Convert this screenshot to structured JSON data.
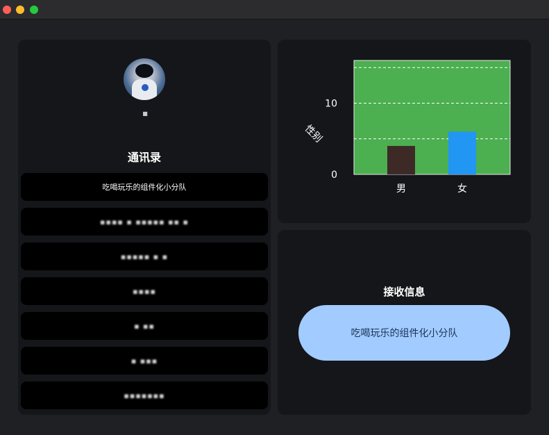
{
  "window": {
    "controls": [
      "close",
      "minimize",
      "zoom"
    ]
  },
  "profile": {
    "avatar": "astronaut-avatar",
    "username": "■"
  },
  "contacts": {
    "title": "通讯录",
    "items": [
      {
        "label": "吃喝玩乐的组件化小分队",
        "blurred": false
      },
      {
        "label": "▪▪▪▪ ▪ ▪▪▪▪▪ ▪▪ ▪",
        "blurred": true
      },
      {
        "label": "▪▪▪▪▪ ▪ ▪",
        "blurred": true
      },
      {
        "label": "▪▪▪▪",
        "blurred": true
      },
      {
        "label": "▪ ▪▪",
        "blurred": true
      },
      {
        "label": "▪ ▪▪▪",
        "blurred": true
      },
      {
        "label": "▪▪▪▪▪▪▪",
        "blurred": true
      }
    ]
  },
  "chart_data": {
    "type": "bar",
    "categories": [
      "男",
      "女"
    ],
    "values": [
      4,
      6
    ],
    "colors": [
      "#3d2a27",
      "#2196f3"
    ],
    "background": "#4caf50",
    "ylabel": "性别",
    "ylim": [
      0,
      16
    ],
    "yticks": [
      0,
      10
    ],
    "grid": "dashed horizontal"
  },
  "receive": {
    "title": "接收信息",
    "group_button": "吃喝玩乐的组件化小分队"
  }
}
